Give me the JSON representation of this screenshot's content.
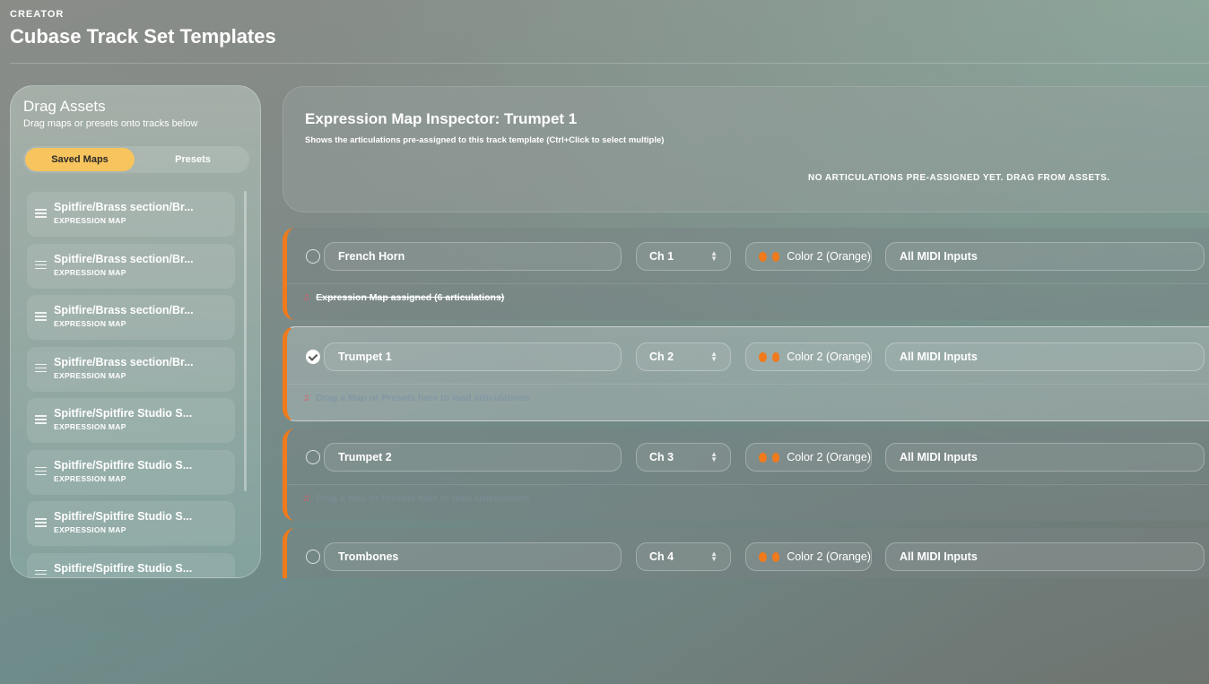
{
  "header": {
    "eyebrow": "CREATOR",
    "title": "Cubase Track Set Templates"
  },
  "assets_panel": {
    "title": "Drag Assets",
    "subtitle": "Drag maps or presets onto tracks below",
    "tabs": [
      {
        "label": "Saved Maps",
        "active": true
      },
      {
        "label": "Presets",
        "active": false
      }
    ],
    "items": [
      {
        "name": "Spitfire/Brass section/Br...",
        "type": "EXPRESSION MAP"
      },
      {
        "name": "Spitfire/Brass section/Br...",
        "type": "EXPRESSION MAP"
      },
      {
        "name": "Spitfire/Brass section/Br...",
        "type": "EXPRESSION MAP"
      },
      {
        "name": "Spitfire/Brass section/Br...",
        "type": "EXPRESSION MAP"
      },
      {
        "name": "Spitfire/Spitfire Studio S...",
        "type": "EXPRESSION MAP"
      },
      {
        "name": "Spitfire/Spitfire Studio S...",
        "type": "EXPRESSION MAP"
      },
      {
        "name": "Spitfire/Spitfire Studio S...",
        "type": "EXPRESSION MAP"
      },
      {
        "name": "Spitfire/Spitfire Studio S...",
        "type": "EXPRESSION MAP"
      }
    ]
  },
  "inspector": {
    "title": "Expression Map Inspector: Trumpet 1",
    "subtitle": "Shows the articulations pre-assigned to this track template (Ctrl+Click to select multiple)",
    "empty_message": "NO ARTICULATIONS PRE-ASSIGNED YET. DRAG FROM ASSETS."
  },
  "tracks": [
    {
      "name": "French Horn",
      "channel": "Ch 1",
      "color": "Color 2 (Orange)",
      "midi_input": "All MIDI Inputs",
      "status": "Expression Map assigned (6 articulations)",
      "selected": false
    },
    {
      "name": "Trumpet 1",
      "channel": "Ch 2",
      "color": "Color 2 (Orange)",
      "midi_input": "All MIDI Inputs",
      "status": "Drag a Map or Presets here to load articulations",
      "selected": true
    },
    {
      "name": "Trumpet 2",
      "channel": "Ch 3",
      "color": "Color 2 (Orange)",
      "midi_input": "All MIDI Inputs",
      "status": "Drag a Map or Presets here to load articulations",
      "selected": false
    },
    {
      "name": "Trombones",
      "channel": "Ch 4",
      "color": "Color 2 (Orange)",
      "midi_input": "All MIDI Inputs",
      "status": "",
      "selected": false
    }
  ],
  "colors": {
    "accent_orange": "#f07a1c",
    "active_tab": "#f7c45e",
    "note_icon": "#e05a6a"
  },
  "icons": {
    "drag_handle": "drag-handle-icon",
    "note": "music-note-icon",
    "chevron": "chevron-updown-icon"
  }
}
